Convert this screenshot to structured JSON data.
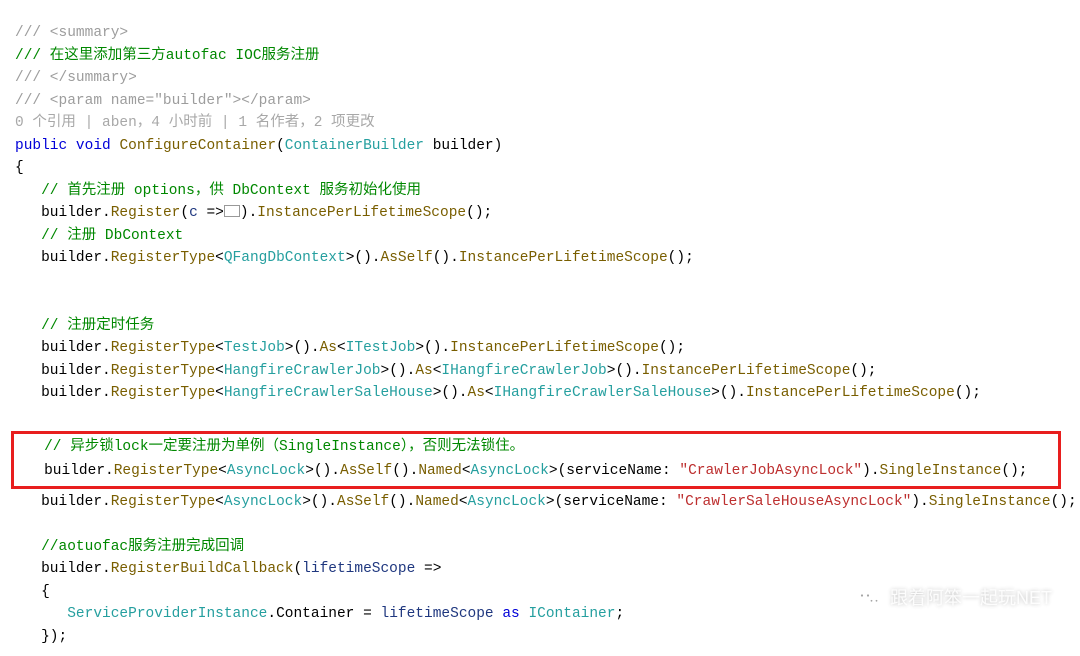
{
  "xmldoc": {
    "l1": "/// <summary>",
    "l2": "/// 在这里添加第三方autofac IOC服务注册",
    "l3": "/// </summary>",
    "l4": "/// <param name=\"builder\"></param>"
  },
  "codelens": "0 个引用 | aben，4 小时前 | 1 名作者，2 项更改",
  "kw": {
    "public": "public",
    "void": "void",
    "as": "as"
  },
  "types": {
    "ContainerBuilder": "ContainerBuilder",
    "QFangDbContext": "QFangDbContext",
    "TestJob": "TestJob",
    "ITestJob": "ITestJob",
    "HangfireCrawlerJob": "HangfireCrawlerJob",
    "IHangfireCrawlerJob": "IHangfireCrawlerJob",
    "HangfireCrawlerSaleHouse": "HangfireCrawlerSaleHouse",
    "IHangfireCrawlerSaleHouse": "IHangfireCrawlerSaleHouse",
    "AsyncLock": "AsyncLock",
    "ServiceProviderInstance": "ServiceProviderInstance",
    "IContainer": "IContainer"
  },
  "methods": {
    "ConfigureContainer": "ConfigureContainer",
    "Register": "Register",
    "InstancePerLifetimeScope": "InstancePerLifetimeScope",
    "RegisterType": "RegisterType",
    "AsSelf": "AsSelf",
    "As": "As",
    "Named": "Named",
    "SingleInstance": "SingleInstance",
    "RegisterBuildCallback": "RegisterBuildCallback"
  },
  "idents": {
    "builder": "builder",
    "c": "c",
    "lifetimeScope": "lifetimeScope",
    "serviceName": "serviceName",
    "Container": "Container"
  },
  "comments": {
    "optionsFirst": "// 首先注册 options，供 DbContext 服务初始化使用",
    "regDbContext": "// 注册 DbContext",
    "regTimer": "// 注册定时任务",
    "asyncLockNote": "// 异步锁lock一定要注册为单例（SingleInstance），否则无法锁住。",
    "callbackNote": "//aotuofac服务注册完成回调"
  },
  "strings": {
    "crawlerJobLock": "\"CrawlerJobAsyncLock\"",
    "crawlerSaleHouseLock": "\"CrawlerSaleHouseAsyncLock\""
  },
  "watermark": "跟着阿笨一起玩NET"
}
